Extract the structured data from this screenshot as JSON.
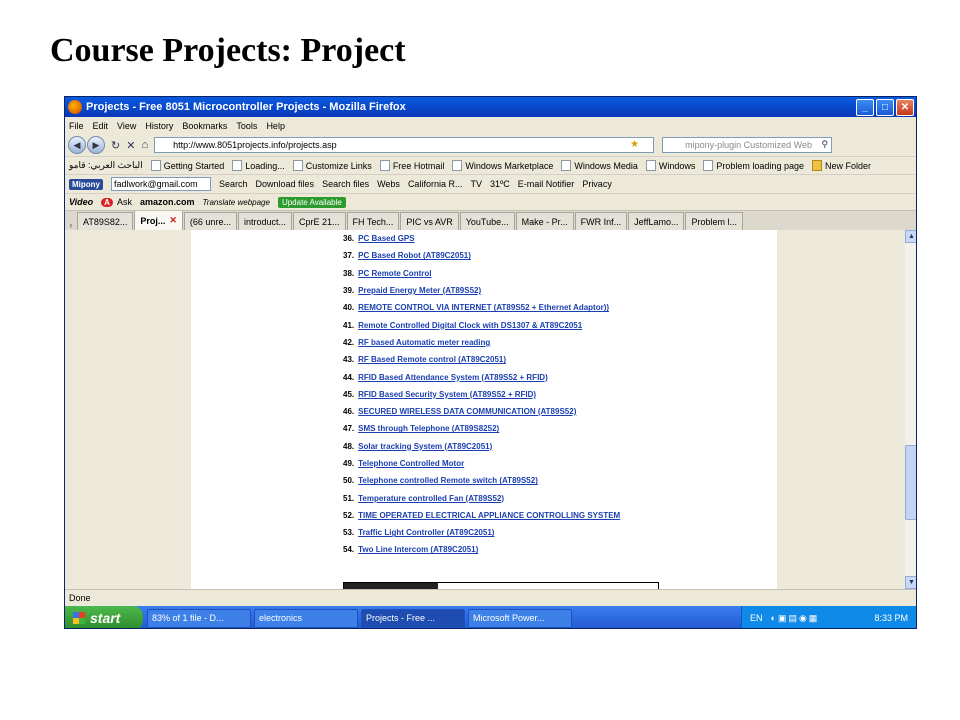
{
  "slide": {
    "title": "Course Projects: Project"
  },
  "window": {
    "title": "Projects - Free 8051 Microcontroller Projects - Mozilla Firefox",
    "controls": {
      "minimize": "_",
      "maximize": "□",
      "close": "✕"
    }
  },
  "menu": [
    "File",
    "Edit",
    "View",
    "History",
    "Bookmarks",
    "Tools",
    "Help"
  ],
  "nav": {
    "url": "http://www.8051projects.info/projects.asp",
    "search_placeholder": "mipony-plugin Customized Web"
  },
  "bookmarks": [
    {
      "label": "الباحث العربي: قامو",
      "icon": "page"
    },
    {
      "label": "Getting Started",
      "icon": "page"
    },
    {
      "label": "Loading...",
      "icon": "page"
    },
    {
      "label": "Customize Links",
      "icon": "page"
    },
    {
      "label": "Free Hotmail",
      "icon": "page"
    },
    {
      "label": "Windows Marketplace",
      "icon": "page"
    },
    {
      "label": "Windows Media",
      "icon": "page"
    },
    {
      "label": "Windows",
      "icon": "page"
    },
    {
      "label": "Problem loading page",
      "icon": "page"
    },
    {
      "label": "New Folder",
      "icon": "folder"
    }
  ],
  "toolbar_mipony": {
    "logo": "Mipony",
    "email": "fadlwork@gmail.com",
    "items": [
      "Search",
      "Download files",
      "Search files",
      "Webs",
      "California R...",
      "TV",
      "31ºC",
      "E-mail Notifier",
      "Privacy"
    ]
  },
  "toolbar_video": {
    "video": "Video",
    "ask": "Ask",
    "amazon": "amazon.com",
    "translate": "Translate webpage",
    "update": "Update Available"
  },
  "tabs": [
    {
      "label": "AT89S82...",
      "active": false
    },
    {
      "label": "Proj...",
      "active": true
    },
    {
      "label": "(66 unre...",
      "active": false
    },
    {
      "label": "introduct...",
      "active": false
    },
    {
      "label": "CprE 21...",
      "active": false
    },
    {
      "label": "FH Tech...",
      "active": false
    },
    {
      "label": "PIC vs AVR",
      "active": false
    },
    {
      "label": "YouTube...",
      "active": false
    },
    {
      "label": "Make - Pr...",
      "active": false
    },
    {
      "label": "FWR Inf...",
      "active": false
    },
    {
      "label": "JeffLamo...",
      "active": false
    },
    {
      "label": "Problem l...",
      "active": false
    }
  ],
  "projects": [
    {
      "num": "36.",
      "title": "PC Based GPS"
    },
    {
      "num": "37.",
      "title": "PC Based Robot (AT89C2051)"
    },
    {
      "num": "38.",
      "title": "PC Remote Control"
    },
    {
      "num": "39.",
      "title": "Prepaid Energy Meter (AT89S52)"
    },
    {
      "num": "40.",
      "title": "REMOTE CONTROL VIA INTERNET (AT89S52 + Ethernet Adaptor))"
    },
    {
      "num": "41.",
      "title": "Remote Controlled Digital Clock with DS1307 & AT89C2051"
    },
    {
      "num": "42.",
      "title": "RF based Automatic meter reading"
    },
    {
      "num": "43.",
      "title": "RF Based Remote control (AT89C2051)"
    },
    {
      "num": "44.",
      "title": "RFID Based Attendance System (AT89S52 + RFID)"
    },
    {
      "num": "45.",
      "title": "RFID Based Security System (AT89S52 + RFID)"
    },
    {
      "num": "46.",
      "title": "SECURED WIRELESS DATA COMMUNICATION (AT89S52)"
    },
    {
      "num": "47.",
      "title": "SMS through Telephone (AT89S8252)"
    },
    {
      "num": "48.",
      "title": "Solar tracking System (AT89C2051)"
    },
    {
      "num": "49.",
      "title": "Telephone Controlled Motor"
    },
    {
      "num": "50.",
      "title": "Telephone controlled Remote switch (AT89S52)"
    },
    {
      "num": "51.",
      "title": "Temperature controlled Fan (AT89S52)"
    },
    {
      "num": "52.",
      "title": "TIME OPERATED ELECTRICAL APPLIANCE CONTROLLING SYSTEM"
    },
    {
      "num": "53.",
      "title": "Traffic Light Controller (AT89C2051)"
    },
    {
      "num": "54.",
      "title": "Two Line Intercom (AT89C2051)"
    }
  ],
  "status": "Done",
  "taskbar": {
    "start": "start",
    "tasks": [
      {
        "label": "83% of 1 file - D...",
        "active": false
      },
      {
        "label": "electronics",
        "active": false
      },
      {
        "label": "Projects - Free ...",
        "active": true
      },
      {
        "label": "Microsoft Power...",
        "active": false
      }
    ],
    "lang": "EN",
    "time": "8:33 PM"
  }
}
